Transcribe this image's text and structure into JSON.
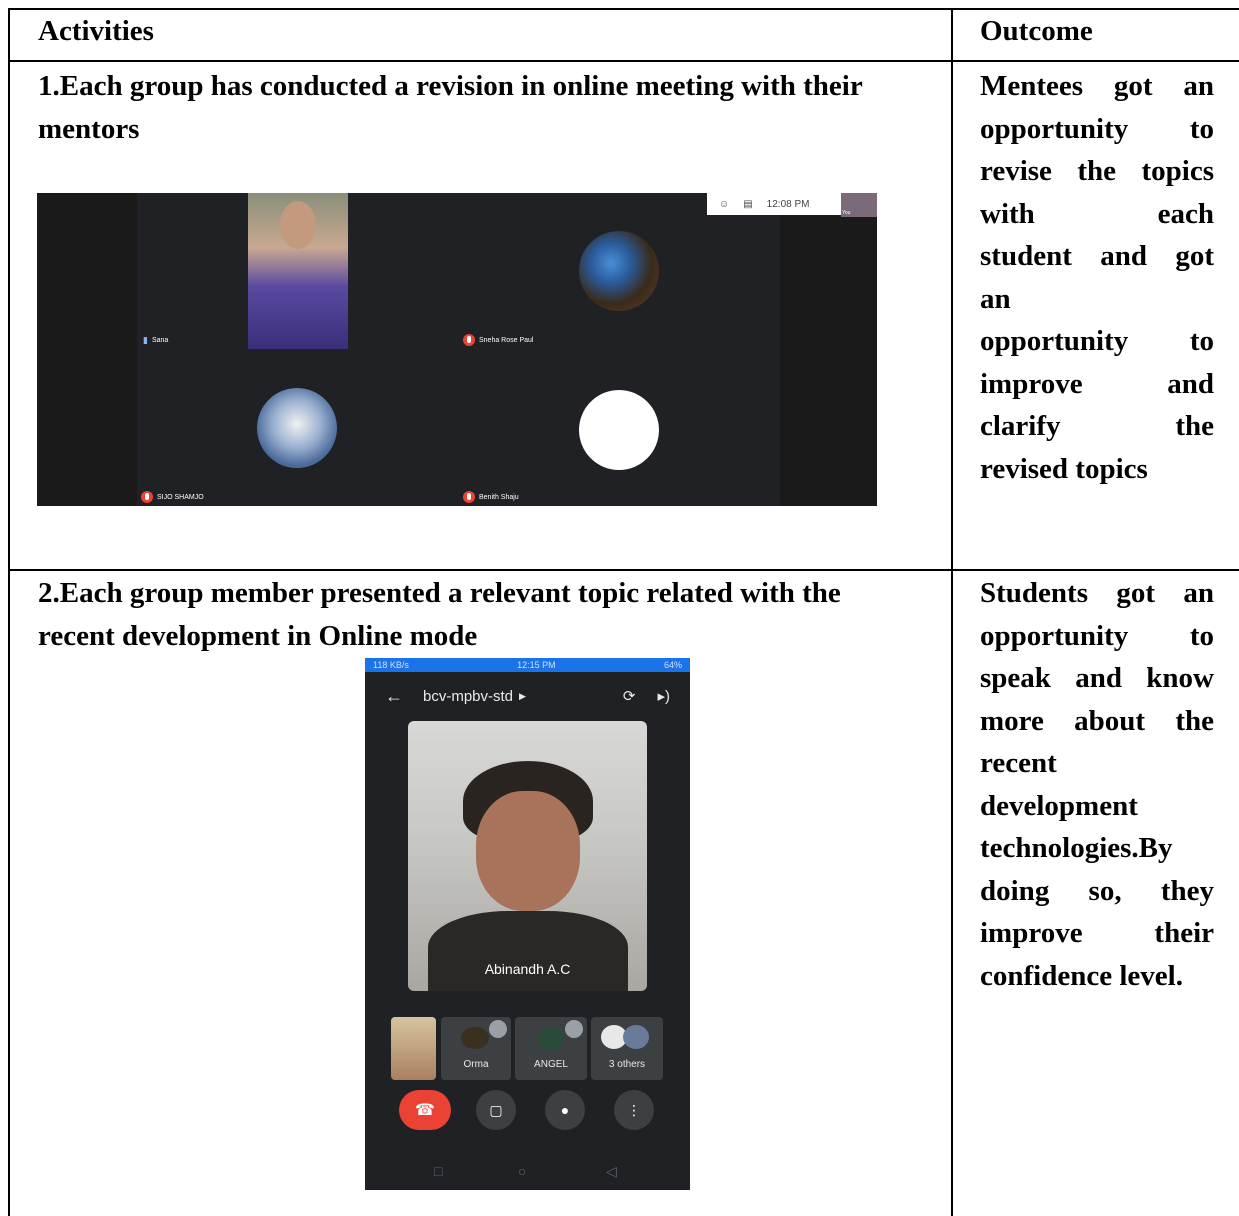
{
  "table": {
    "headers": {
      "activities": "Activities",
      "outcome": "Outcome"
    },
    "rows": [
      {
        "activity": "1.Each group has conducted a revision in online meeting with their mentors",
        "outcome_lines": [
          "Mentees got an",
          "opportunity to",
          "revise the topics",
          "with each",
          "student and got",
          "an",
          "opportunity to",
          "improve and",
          "clarify the",
          "revised topics"
        ]
      },
      {
        "activity": "2.Each group member presented a relevant topic related with the recent development in Online mode",
        "outcome_lines": [
          "Students got an",
          "opportunity to",
          "speak and know",
          "more about the",
          "recent",
          "development",
          "technologies.By",
          "doing so, they",
          "improve their",
          "confidence level."
        ]
      }
    ]
  },
  "screenshot1": {
    "time": "12:08 PM",
    "self_label": "You",
    "participants": [
      "Sana",
      "Sneha Rose Paul",
      "SIJO SHAMJO",
      "Benith Shaju"
    ]
  },
  "screenshot2": {
    "status_left": "118 KB/s",
    "status_time": "12:15 PM",
    "status_battery": "64%",
    "meeting_code": "bcv-mpbv-std",
    "speaker_name": "Abinandh A.C",
    "thumbs": [
      "Orma",
      "ANGEL",
      "3 others"
    ]
  },
  "colors": {
    "meet_bg": "#202124",
    "end_call": "#ea4335",
    "status_bar": "#1a73e8"
  }
}
